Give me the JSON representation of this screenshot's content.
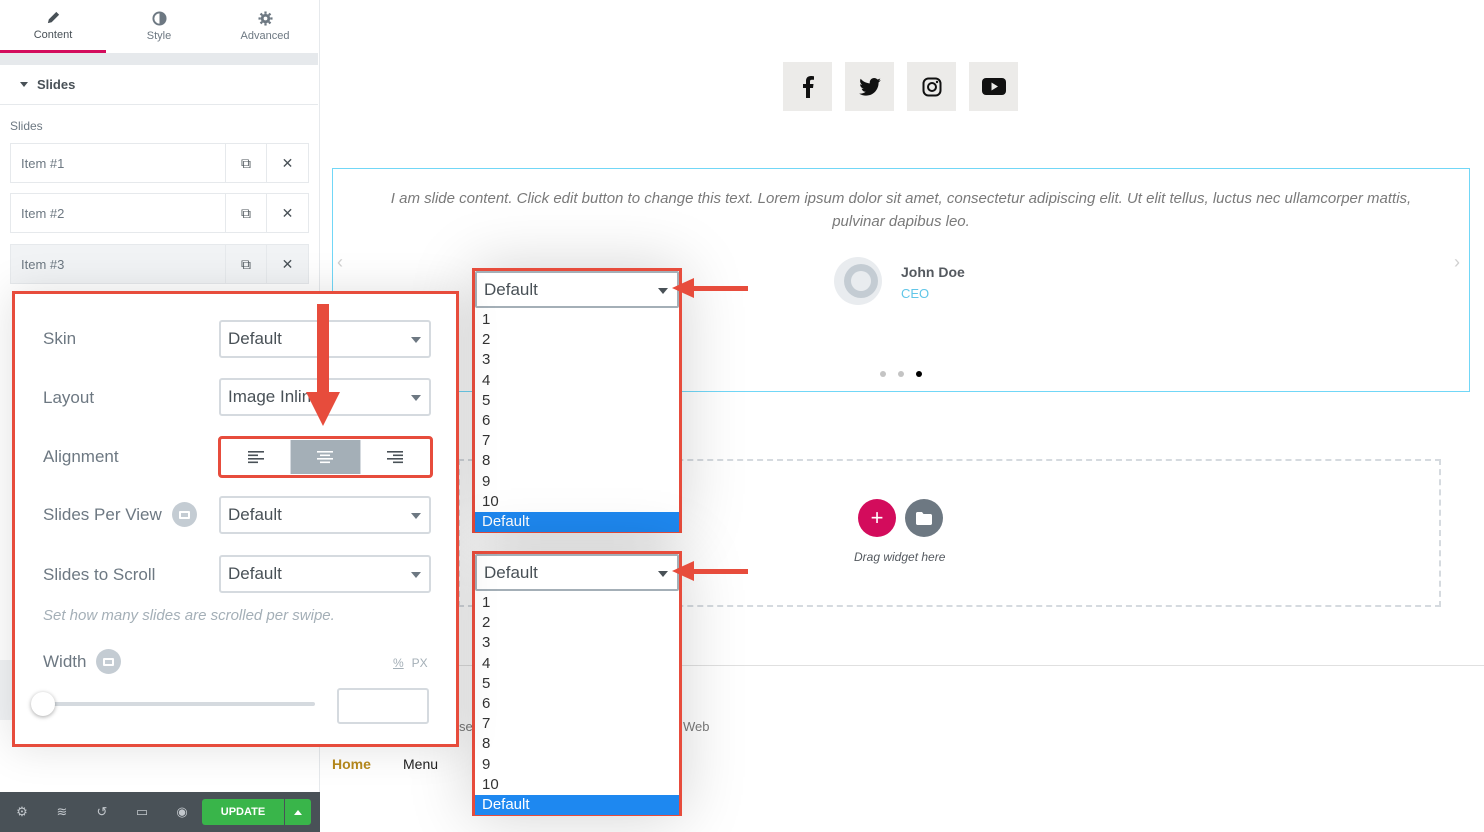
{
  "panel": {
    "tabs": [
      {
        "label": "Content",
        "icon": "pencil-icon"
      },
      {
        "label": "Style",
        "icon": "contrast-icon"
      },
      {
        "label": "Advanced",
        "icon": "gear-icon"
      }
    ],
    "section_title": "Slides",
    "slides_label": "Slides",
    "items": [
      "Item #1",
      "Item #2",
      "Item #3"
    ],
    "update_label": "UPDATE"
  },
  "callout": {
    "skin_label": "Skin",
    "skin_value": "Default",
    "layout_label": "Layout",
    "layout_value": "Image Inline",
    "alignment_label": "Alignment",
    "slides_per_view_label": "Slides Per View",
    "slides_per_view_value": "Default",
    "slides_to_scroll_label": "Slides to Scroll",
    "slides_to_scroll_value": "Default",
    "scroll_hint": "Set how many slides are scrolled per swipe.",
    "width_label": "Width",
    "unit_percent": "%",
    "unit_px": "PX"
  },
  "dropdown_top": {
    "selected": "Default",
    "options": [
      "1",
      "2",
      "3",
      "4",
      "5",
      "6",
      "7",
      "8",
      "9",
      "10",
      "Default"
    ]
  },
  "dropdown_bottom": {
    "selected": "Default",
    "options": [
      "1",
      "2",
      "3",
      "4",
      "5",
      "6",
      "7",
      "8",
      "9",
      "10",
      "Default"
    ]
  },
  "preview": {
    "social_icons": [
      "facebook-icon",
      "twitter-icon",
      "instagram-icon",
      "youtube-icon"
    ],
    "quote": "I am slide content. Click edit button to change this text. Lorem ipsum dolor sit amet, consectetur adipiscing elit. Ut elit tellus, luctus nec ullamcorper mattis, pulvinar dapibus leo.",
    "name": "John Doe",
    "title": "CEO",
    "drag_text": "Drag widget here",
    "footer_fragment_left": "se",
    "footer_fragment_right": "Web",
    "menu": [
      "Home",
      "Menu"
    ]
  },
  "colors": {
    "accent": "#d30c5c",
    "highlight_red": "#e74c3c",
    "update_green": "#39b54a",
    "option_selected": "#1e88f0",
    "testimonial_border": "#71d7f7"
  }
}
